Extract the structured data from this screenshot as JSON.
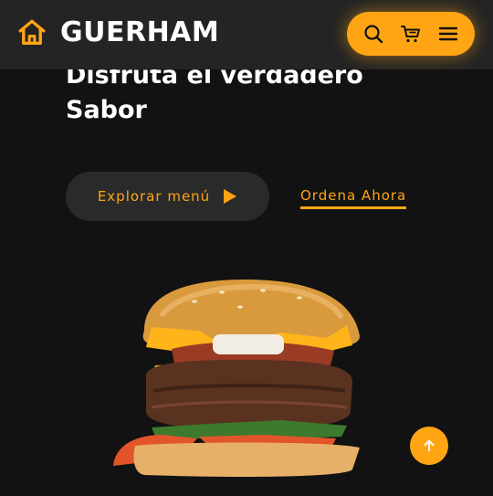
{
  "header": {
    "brand_name": "GUERHAM",
    "accent_color": "#ffa514",
    "icons": [
      "home-icon",
      "search-icon",
      "cart-icon",
      "menu-icon"
    ]
  },
  "hero": {
    "title": "Disfruta el verdadero Sabor",
    "explore_label": "Explorar menú",
    "order_label": "Ordena Ahora"
  },
  "image": {
    "subject": "burger"
  },
  "back_to_top": {
    "icon": "arrow-up-icon"
  }
}
